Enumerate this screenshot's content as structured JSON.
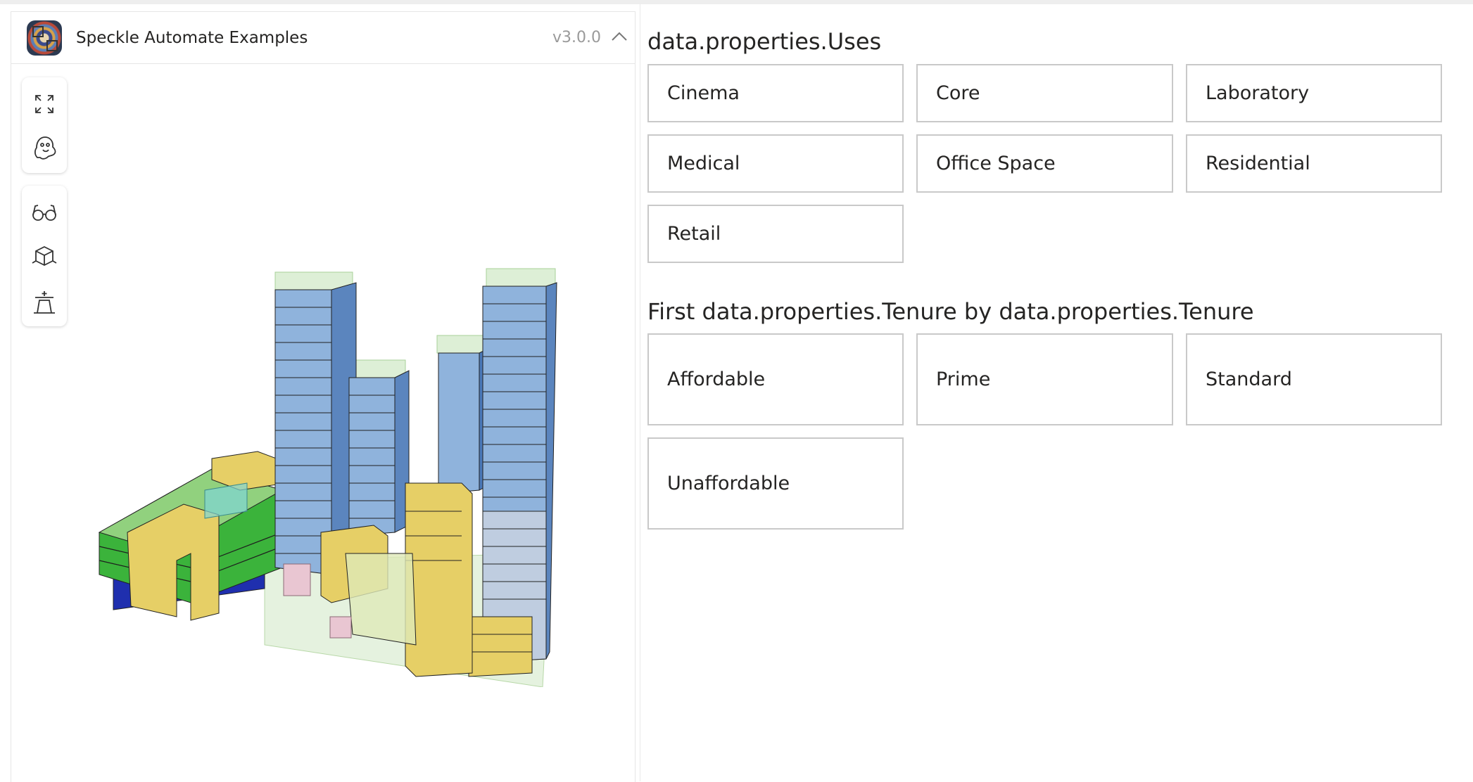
{
  "app": {
    "title": "Speckle Automate Examples",
    "version": "v3.0.0"
  },
  "toolbar": {
    "group1": [
      {
        "name": "zoom-extents-icon",
        "label": "Zoom extents"
      },
      {
        "name": "ghost-icon",
        "label": "Ghost mode"
      }
    ],
    "group2": [
      {
        "name": "glasses-icon",
        "label": "View modes"
      },
      {
        "name": "cube-icon",
        "label": "Views"
      },
      {
        "name": "section-icon",
        "label": "Section"
      }
    ]
  },
  "uses_filter": {
    "title": "data.properties.Uses",
    "options": [
      "Cinema",
      "Core",
      "Laboratory",
      "Medical",
      "Office Space",
      "Residential",
      "Retail"
    ]
  },
  "tenure_filter": {
    "title": "First data.properties.Tenure by data.properties.Tenure",
    "options": [
      "Affordable",
      "Prime",
      "Standard",
      "Unaffordable"
    ]
  },
  "colors": {
    "chip_border": "#c9c9c9",
    "residential_blue": "#8fb3dc",
    "office_yellow": "#e6cf66",
    "green": "#3bb33b",
    "dark_blue": "#1f2fae",
    "ghost_green": "#cfe8c4"
  }
}
